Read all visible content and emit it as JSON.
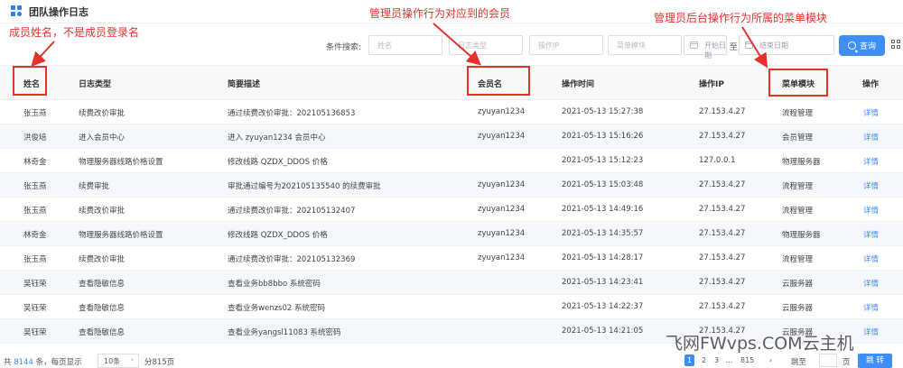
{
  "header": {
    "title": "团队操作日志"
  },
  "annotations": {
    "member_name": "成员姓名，不是成员登录名",
    "account_name": "管理员操作行为对应到的会员",
    "menu_module": "管理员后台操作行为所属的菜单模块"
  },
  "filters": {
    "label": "条件搜索:",
    "name_placeholder": "姓名",
    "log_type_placeholder": "日志类型",
    "ip_placeholder": "操作IP",
    "menu_placeholder": "菜单模块",
    "start_date_placeholder": "开始日期",
    "range_separator": "至",
    "end_date_placeholder": "结束日期",
    "search_label": "查询"
  },
  "table": {
    "columns": {
      "name": "姓名",
      "log_type": "日志类型",
      "summary": "简要描述",
      "account": "会员名",
      "time": "操作时间",
      "ip": "操作IP",
      "menu": "菜单模块",
      "action": "操作"
    },
    "rows": [
      {
        "name": "张玉燕",
        "log_type": "续费改价审批",
        "summary": "通过续费改价审批：202105136853",
        "account": "zyuyan1234",
        "time": "2021-05-13 15:27:38",
        "ip": "27.153.4.27",
        "menu": "流程管理",
        "action": "详情"
      },
      {
        "name": "洪俊培",
        "log_type": "进入会员中心",
        "summary": "进入 zyuyan1234 会员中心",
        "account": "zyuyan1234",
        "time": "2021-05-13 15:16:26",
        "ip": "27.153.4.27",
        "menu": "会员管理",
        "action": "详情"
      },
      {
        "name": "林奇金",
        "log_type": "物理服务器线路价格设置",
        "summary": "修改线路 QZDX_DDOS 价格",
        "account": "",
        "time": "2021-05-13 15:12:23",
        "ip": "127.0.0.1",
        "menu": "物理服务器",
        "action": "详情"
      },
      {
        "name": "张玉燕",
        "log_type": "续费审批",
        "summary": "审批通过编号为202105135540 的续费审批",
        "account": "zyuyan1234",
        "time": "2021-05-13 15:03:48",
        "ip": "27.153.4.27",
        "menu": "流程管理",
        "action": "详情"
      },
      {
        "name": "张玉燕",
        "log_type": "续费改价审批",
        "summary": "通过续费改价审批：202105132407",
        "account": "zyuyan1234",
        "time": "2021-05-13 14:49:16",
        "ip": "27.153.4.27",
        "menu": "流程管理",
        "action": "详情"
      },
      {
        "name": "林奇金",
        "log_type": "物理服务器线路价格设置",
        "summary": "修改线路 QZDX_DDOS 价格",
        "account": "zyuyan1234",
        "time": "2021-05-13 14:35:57",
        "ip": "27.153.4.27",
        "menu": "物理服务器",
        "action": "详情"
      },
      {
        "name": "张玉燕",
        "log_type": "续费改价审批",
        "summary": "通过续费改价审批：202105132369",
        "account": "zyuyan1234",
        "time": "2021-05-13 14:28:17",
        "ip": "27.153.4.27",
        "menu": "流程管理",
        "action": "详情"
      },
      {
        "name": "吴钰荣",
        "log_type": "查看隐敏信息",
        "summary": "查看业务bb8bbo 系统密码",
        "account": "",
        "time": "2021-05-13 14:23:41",
        "ip": "27.153.4.27",
        "menu": "云服务器",
        "action": "详情"
      },
      {
        "name": "吴钰荣",
        "log_type": "查看隐敏信息",
        "summary": "查看业务wenzs02 系统密码",
        "account": "",
        "time": "2021-05-13 14:22:37",
        "ip": "27.153.4.27",
        "menu": "云服务器",
        "action": "详情"
      },
      {
        "name": "吴钰荣",
        "log_type": "查看隐敏信息",
        "summary": "查看业务yangsl11083 系统密码",
        "account": "",
        "time": "2021-05-13 14:21:05",
        "ip": "27.153.4.27",
        "menu": "云服务器",
        "action": "详情"
      }
    ]
  },
  "pagination": {
    "total_prefix": "共",
    "total": "8144",
    "total_suffix": "条，每页显示",
    "page_size": "10条",
    "pages_label": "分815页",
    "pages": [
      "1",
      "2",
      "3",
      "...",
      "815"
    ],
    "jump_label": "跳至",
    "page_unit": "页",
    "go_label": "跳 转"
  },
  "watermark": "飞网FWvps.COM云主机",
  "colors": {
    "accent": "#3e8ef7",
    "annotation": "#e5322d",
    "stripe": "#f4f7fc"
  }
}
